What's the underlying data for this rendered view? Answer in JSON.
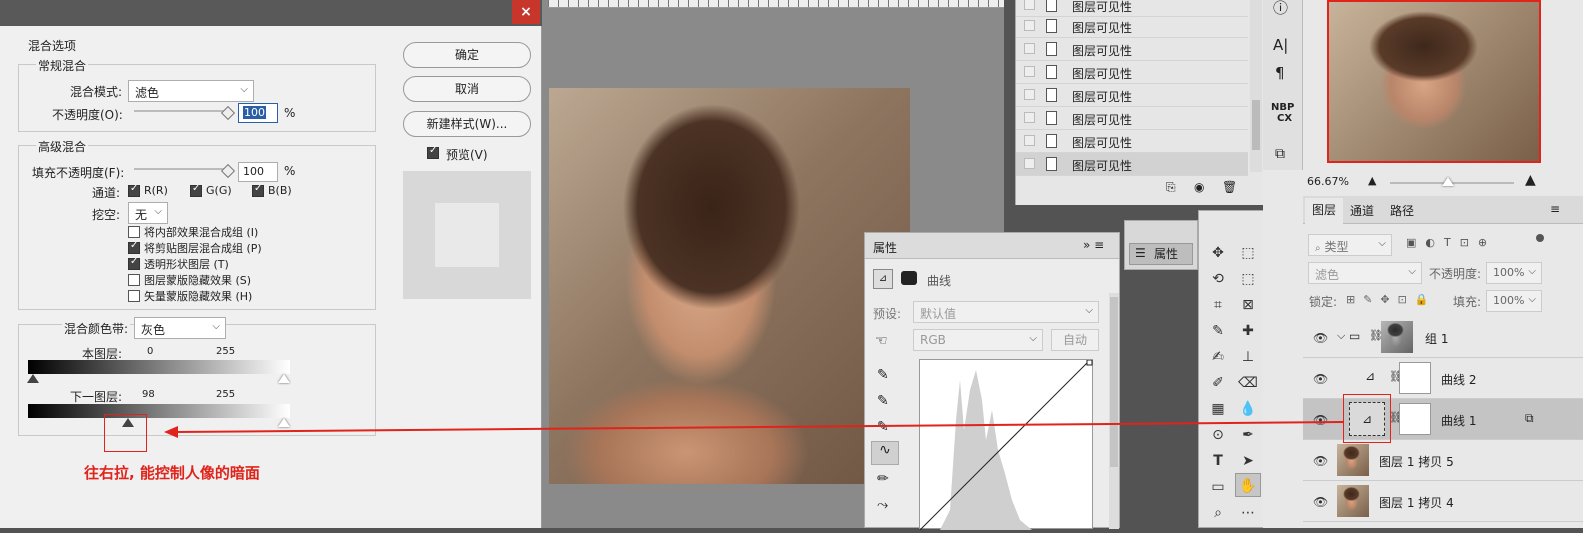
{
  "dialog": {
    "close_label": "×",
    "blend_options_title": "混合选项",
    "general_blending_title": "常规混合",
    "blend_mode_label": "混合模式:",
    "blend_mode_value": "滤色",
    "opacity_label": "不透明度(O):",
    "opacity_value": "100",
    "opacity_unit": "%",
    "advanced_blending_title": "高级混合",
    "fill_opacity_label": "填充不透明度(F):",
    "fill_opacity_value": "100",
    "fill_opacity_unit": "%",
    "channels_label": "通道:",
    "channel_r": "R(R)",
    "channel_g": "G(G)",
    "channel_b": "B(B)",
    "knockout_label": "挖空:",
    "knockout_value": "无",
    "options": [
      {
        "label": "将内部效果混合成组 (I)",
        "checked": false
      },
      {
        "label": "将剪贴图层混合成组 (P)",
        "checked": true
      },
      {
        "label": "透明形状图层 (T)",
        "checked": true
      },
      {
        "label": "图层蒙版隐藏效果 (S)",
        "checked": false
      },
      {
        "label": "矢量蒙版隐藏效果 (H)",
        "checked": false
      }
    ],
    "blend_if_label": "混合颜色带:",
    "blend_if_value": "灰色",
    "this_layer_label": "本图层:",
    "this_layer_min": "0",
    "this_layer_max": "255",
    "underlying_label": "下一图层:",
    "underlying_min": "98",
    "underlying_max": "255",
    "ok_button": "确定",
    "cancel_button": "取消",
    "new_style_button": "新建样式(W)...",
    "preview_label": "预览(V)",
    "preview_checked": true
  },
  "annotation": {
    "text": "往右拉, 能控制人像的暗面",
    "color": "#e0241b"
  },
  "layer_visibility_list": {
    "items": [
      "图层可见性",
      "图层可见性",
      "图层可见性",
      "图层可见性",
      "图层可见性",
      "图层可见性",
      "图层可见性",
      "图层可见性"
    ]
  },
  "properties_panel": {
    "title": "属性",
    "header_label": "曲线",
    "preset_label": "预设:",
    "preset_value": "默认值",
    "channel_value": "RGB",
    "auto_button": "自动"
  },
  "properties_dock": {
    "label": "属性"
  },
  "navigator": {
    "zoom": "66.67%"
  },
  "right_toolbar": {
    "info": "ⓘ",
    "char": "A|",
    "para": "¶",
    "nbp": "NBP",
    "cx": "CX"
  },
  "layers_panel": {
    "tabs": [
      "图层",
      "通道",
      "路径"
    ],
    "filter_value": "类型",
    "blend_value": "滤色",
    "opacity_label": "不透明度:",
    "opacity_value": "100%",
    "lock_label": "锁定:",
    "fill_label": "填充:",
    "fill_value": "100%",
    "layers": [
      {
        "name": "组 1"
      },
      {
        "name": "曲线 2"
      },
      {
        "name": "曲线 1"
      },
      {
        "name": "图层 1 拷贝 5"
      },
      {
        "name": "图层 1 拷贝 4"
      }
    ]
  }
}
